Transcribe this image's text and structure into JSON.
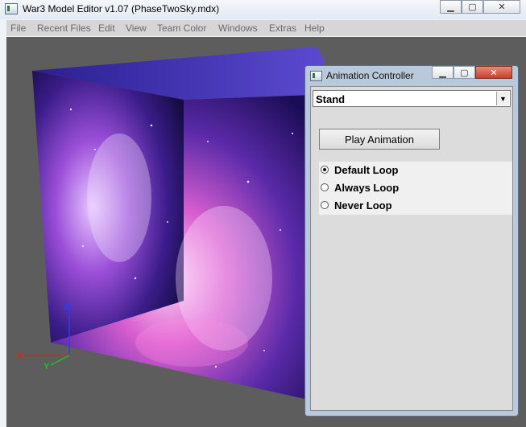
{
  "window": {
    "title": "War3 Model Editor v1.07 (PhaseTwoSky.mdx)",
    "controls": [
      "minimize",
      "maximize",
      "close"
    ]
  },
  "menu": {
    "items": [
      "File",
      "Recent Files",
      "Edit",
      "View",
      "Team Color",
      "Windows",
      "Extras",
      "Help"
    ]
  },
  "viewport": {
    "axes": {
      "x": "X",
      "y": "Y",
      "z": "Z"
    },
    "colors": {
      "background": "#5d5d5d",
      "x_axis": "#e02020",
      "y_axis": "#20c020",
      "z_axis": "#2040ff"
    }
  },
  "animation_controller": {
    "title": "Animation Controller",
    "sequence_selected": "Stand",
    "play_label": "Play Animation",
    "loop_options": [
      {
        "label": "Default Loop",
        "checked": true
      },
      {
        "label": "Always Loop",
        "checked": false
      },
      {
        "label": "Never Loop",
        "checked": false
      }
    ]
  }
}
